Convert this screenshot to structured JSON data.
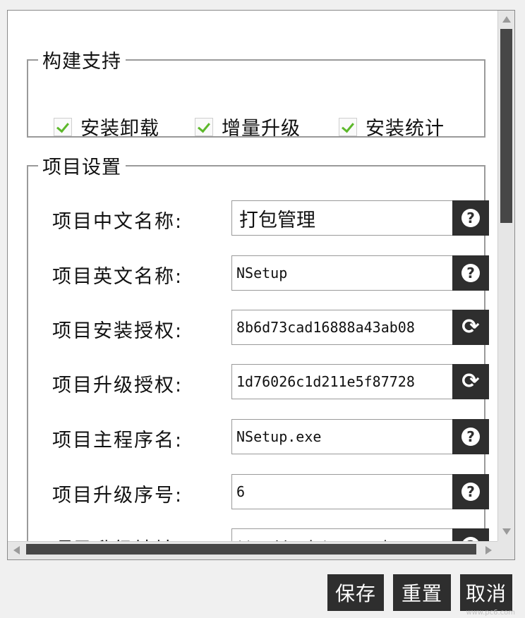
{
  "build_support": {
    "legend": "构建支持",
    "options": [
      {
        "label": "安装卸载",
        "checked": true
      },
      {
        "label": "增量升级",
        "checked": true
      },
      {
        "label": "安装统计",
        "checked": true
      }
    ]
  },
  "project_settings": {
    "legend": "项目设置",
    "rows": [
      {
        "label": "项目中文名称:",
        "value": "打包管理",
        "button_icon": "help-icon"
      },
      {
        "label": "项目英文名称:",
        "value": "NSetup",
        "button_icon": "help-icon"
      },
      {
        "label": "项目安装授权:",
        "value": "8b6d73cad16888a43ab08",
        "button_icon": "refresh-icon"
      },
      {
        "label": "项目升级授权:",
        "value": "1d76026c1d211e5f87728",
        "button_icon": "refresh-icon"
      },
      {
        "label": "项目主程序名:",
        "value": "NSetup.exe",
        "button_icon": "help-icon"
      },
      {
        "label": "项目升级序号:",
        "value": "6",
        "button_icon": "help-icon"
      },
      {
        "label": "项目升级地址:",
        "value": "ttp://update.aceui.cn",
        "button_icon": "help-icon"
      }
    ]
  },
  "actions": {
    "save": "保存",
    "reset": "重置",
    "cancel": "取消"
  },
  "icons": {
    "help": "?",
    "refresh": "⟳"
  },
  "watermark": "www.pc6.com",
  "colors": {
    "button_bg": "#2e2e2e",
    "check_green": "#5cb82a",
    "border": "#9a9a9a"
  }
}
